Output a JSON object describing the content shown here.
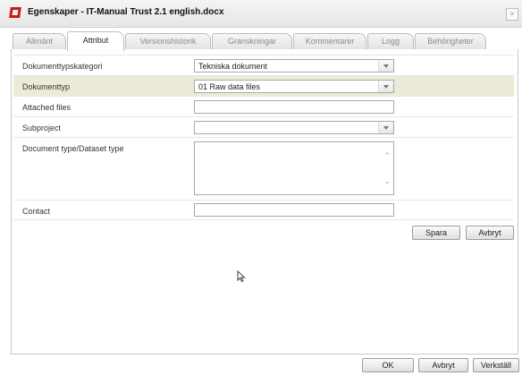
{
  "window": {
    "title": "Egenskaper - IT-Manual Trust 2.1 english.docx",
    "close_label": "×"
  },
  "tabs": [
    {
      "label": "Allmänt",
      "active": false
    },
    {
      "label": "Attribut",
      "active": true
    },
    {
      "label": "Versionshistorik",
      "active": false
    },
    {
      "label": "Granskningar",
      "active": false
    },
    {
      "label": "Kommentarer",
      "active": false
    },
    {
      "label": "Logg",
      "active": false
    },
    {
      "label": "Behörigheter",
      "active": false
    }
  ],
  "form": {
    "doc_category": {
      "label": "Dokumenttypskategori",
      "value": "Tekniska dokument"
    },
    "doc_type": {
      "label": "Dokumenttyp",
      "value": "01 Raw data files"
    },
    "attached_files": {
      "label": "Attached files",
      "value": ""
    },
    "subproject": {
      "label": "Subproject",
      "value": ""
    },
    "dataset_type": {
      "label": "Document type/Dataset type",
      "value": ""
    },
    "contact": {
      "label": "Contact",
      "value": ""
    }
  },
  "form_buttons": {
    "save": "Spara",
    "cancel": "Avbryt"
  },
  "footer_buttons": {
    "ok": "OK",
    "cancel": "Avbryt",
    "apply": "Verkställ"
  },
  "colors": {
    "highlight_row": "#ecebd7",
    "app_icon": "#cc1a1a"
  }
}
